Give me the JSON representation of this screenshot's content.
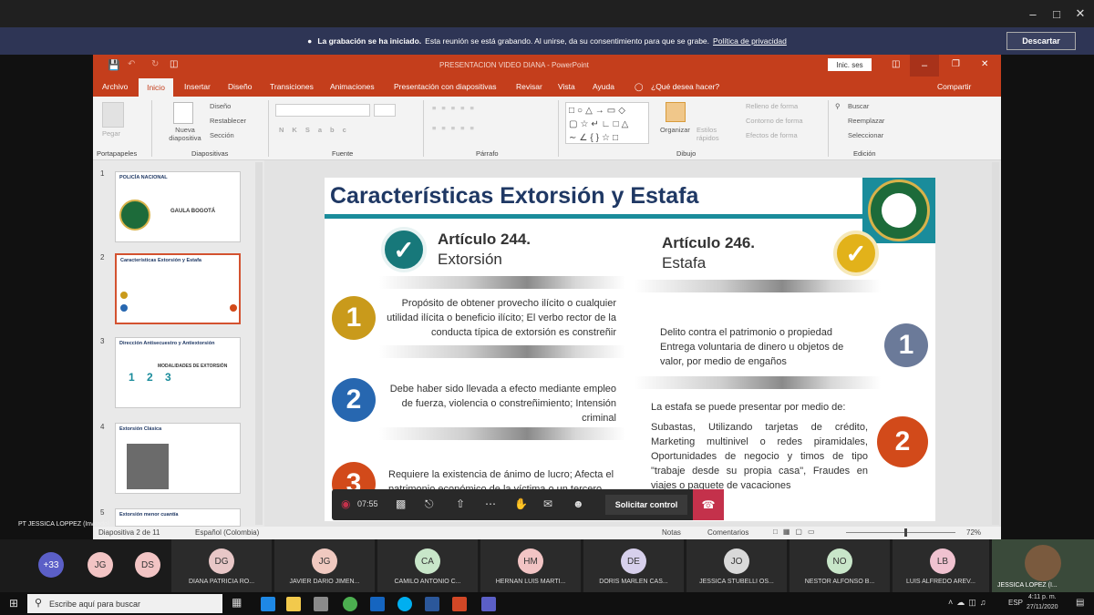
{
  "teams": {
    "recording_bold": "La grabación se ha iniciado.",
    "recording_text": "Esta reunión se está grabando. Al unirse, da su consentimiento para que se grabe.",
    "privacy_link": "Política de privacidad",
    "dismiss": "Descartar"
  },
  "ppt": {
    "window_title": "PRESENTACION VIDEO DIANA - PowerPoint",
    "signin": "Inic. ses",
    "tabs": [
      "Archivo",
      "Inicio",
      "Insertar",
      "Diseño",
      "Transiciones",
      "Animaciones",
      "Presentación con diapositivas",
      "Revisar",
      "Vista",
      "Ayuda"
    ],
    "tell_me": "¿Qué desea hacer?",
    "share": "Compartir",
    "ribbon": {
      "paste": "Pegar",
      "new_slide": "Nueva diapositiva",
      "design": "Diseño",
      "reset": "Restablecer",
      "section": "Sección",
      "group_clipboard": "Portapapeles",
      "group_slides": "Diapositivas",
      "group_font": "Fuente",
      "group_paragraph": "Párrafo",
      "group_drawing": "Dibujo",
      "group_editing": "Edición",
      "arrange": "Organizar",
      "quick_styles": "Estilos rápidos",
      "shape_fill": "Relleno de forma",
      "shape_outline": "Contorno de forma",
      "shape_effects": "Efectos de forma",
      "find": "Buscar",
      "replace": "Reemplazar",
      "select": "Seleccionar"
    },
    "thumbs": [
      {
        "n": "1",
        "title": "POLICÍA NACIONAL",
        "sub": "GAULA BOGOTÁ"
      },
      {
        "n": "2",
        "title": "Características Extorsión y Estafa",
        "sub": ""
      },
      {
        "n": "3",
        "title": "Dirección Antisecuestro y Antiextorsión",
        "sub": "MODALIDADES DE EXTORSIÓN"
      },
      {
        "n": "4",
        "title": "Extorsión Clásica",
        "sub": ""
      },
      {
        "n": "5",
        "title": "Extorsión menor cuantía",
        "sub": ""
      }
    ],
    "slide": {
      "title": "Características Extorsión y Estafa",
      "art1_title": "Artículo 244.",
      "art1_sub": "Extorsión",
      "art2_title": "Artículo 246.",
      "art2_sub": "Estafa",
      "left_items": [
        {
          "n": "1",
          "text": "Propósito de obtener provecho ilícito o cualquier utilidad ilícita o beneficio ilícito; El verbo rector de la conducta típica de extorsión es constreñir"
        },
        {
          "n": "2",
          "text": "Debe haber sido llevada a efecto mediante empleo de fuerza, violencia o constreñimiento; Intensión criminal"
        },
        {
          "n": "3",
          "text": "Requiere la existencia de ánimo de lucro; Afecta el patrimonio económico de la víctima o un tercero"
        }
      ],
      "right_item1": "Delito contra el patrimonio o propiedad Entrega voluntaria de dinero u objetos de valor, por medio de engaños",
      "right_n1": "1",
      "right_heading": "La estafa se puede presentar por medio de:",
      "right_item2": "Subastas, Utilizando tarjetas de crédito, Marketing multinivel o redes piramidales, Oportunidades de negocio y timos de tipo \"trabaje desde su propia casa\", Fraudes en viajes o paquete de vacaciones",
      "right_n2": "2"
    },
    "status": {
      "slide": "Diapositiva 2 de 11",
      "lang": "Español (Colombia)",
      "notes": "Notas",
      "comments": "Comentarios",
      "zoom": "72%"
    },
    "presenter": "PT JESSICA LOPPEZ (Invitado)"
  },
  "meeting": {
    "timer": "07:55",
    "request_control": "Solicitar control"
  },
  "people": {
    "overflow": "+33",
    "initials_a": "JG",
    "initials_b": "DS",
    "tiles": [
      {
        "i": "DG",
        "name": "DIANA PATRICIA RO...",
        "c": "#e8c7c7"
      },
      {
        "i": "JG",
        "name": "JAVIER DARIO JIMEN...",
        "c": "#f0c9c0"
      },
      {
        "i": "CA",
        "name": "CAMILO ANTONIO C...",
        "c": "#c8e6c9"
      },
      {
        "i": "HM",
        "name": "HERNAN LUIS MARTI...",
        "c": "#f2c4c4"
      },
      {
        "i": "DE",
        "name": "DORIS MARLEN CAS...",
        "c": "#d7d0ec"
      },
      {
        "i": "JO",
        "name": "JESSICA STUBELLI OS...",
        "c": "#d9d9d9"
      },
      {
        "i": "NO",
        "name": "NESTOR ALFONSO B...",
        "c": "#c8e6c9"
      },
      {
        "i": "LB",
        "name": "LUIS ALFREDO AREV...",
        "c": "#f0c2d0"
      }
    ],
    "self_name": "JESSICA LOPEZ (I..."
  },
  "taskbar": {
    "search": "Escribe aquí para buscar",
    "lang": "ESP",
    "time": "4:11 p. m.",
    "date": "27/11/2020"
  }
}
